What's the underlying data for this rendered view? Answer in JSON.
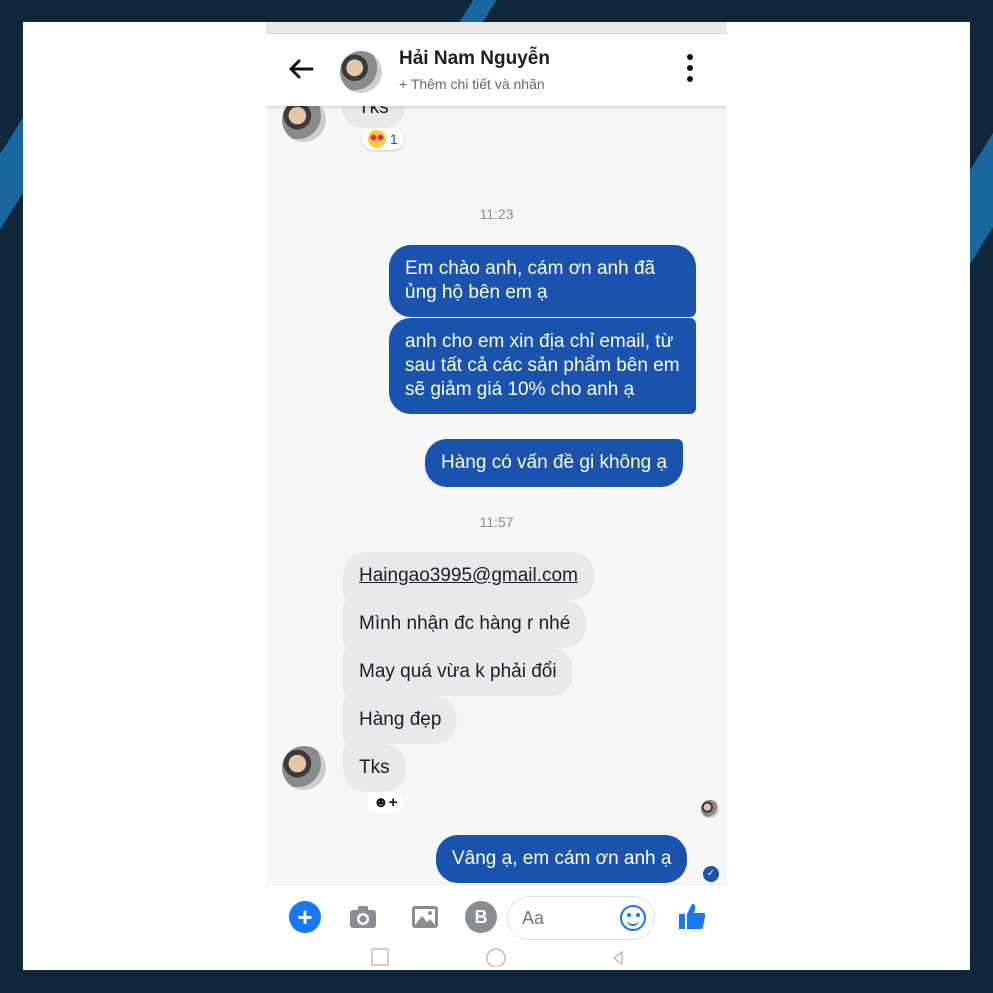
{
  "colors": {
    "accent": "#1a53ad",
    "messenger_blue": "#1877f2",
    "incoming_bubble": "#e9e9eb",
    "background": "#0f2738"
  },
  "header": {
    "contact_name": "Hải Nam Nguyễn",
    "subtitle": "+ Thêm chi tiết và nhãn"
  },
  "messages_top": {
    "partial_text": "Tks",
    "reaction_count": "1"
  },
  "timestamps": [
    "11:23",
    "11:57"
  ],
  "outgoing_1": [
    "Em chào anh, cám ơn anh đã ủng hộ bên em ạ",
    "anh cho em xin địa chỉ email, từ sau tất cả các sản phẩm bên em sẽ giảm giá 10% cho anh ạ",
    "Hàng có vấn đề gi không ạ"
  ],
  "incoming": [
    "Haingao3995@gmail.com",
    "Mình nhận đc hàng r nhé",
    "May quá vừa k phải đổi",
    "Hàng đẹp",
    "Tks"
  ],
  "add_reaction_label": "☻+",
  "outgoing_2": "Vâng ạ, em cám ơn anh ạ",
  "composer": {
    "placeholder": "Aa",
    "plus_label": "+",
    "coin_label": "B"
  },
  "icons": [
    "back-arrow-icon",
    "more-vertical-icon",
    "plus-icon",
    "camera-icon",
    "image-icon",
    "coin-icon",
    "emoji-icon",
    "thumbs-up-icon"
  ]
}
